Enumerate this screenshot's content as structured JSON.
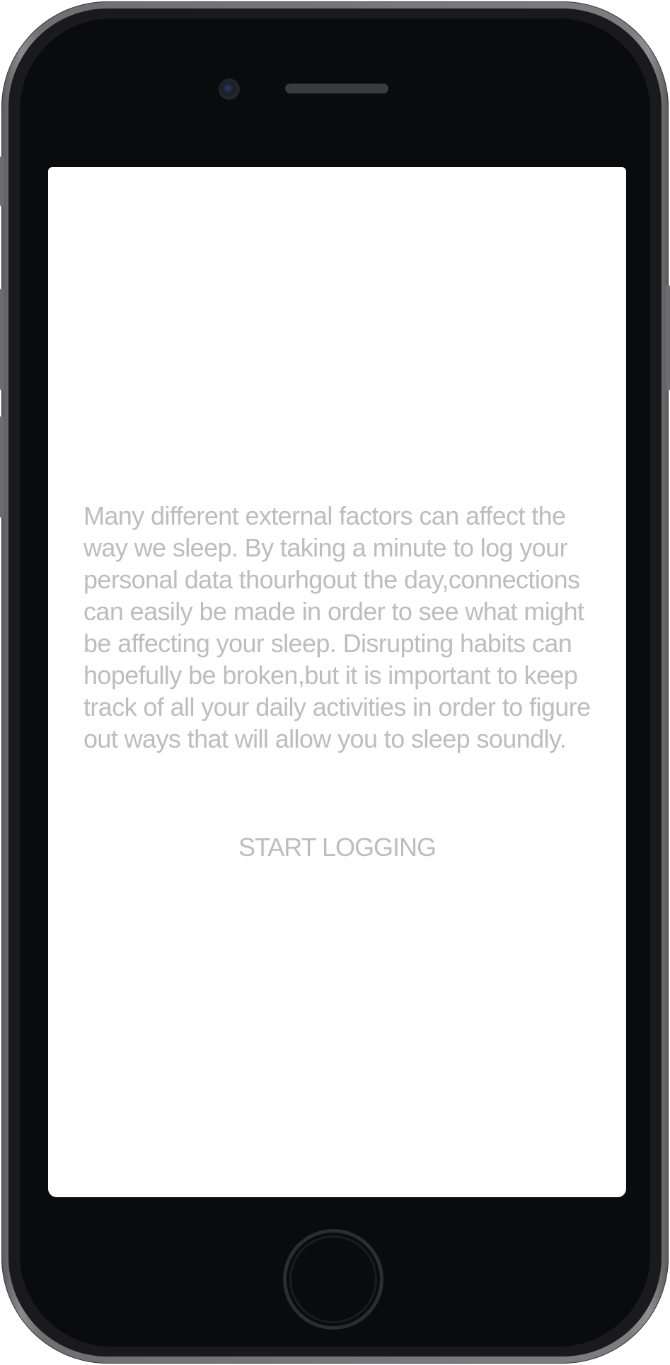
{
  "onboarding": {
    "intro_text": "Many different external factors can affect the way we sleep. By taking a minute to log your personal data thourhgout the day,connections can easily be made in order to see what might be affecting your sleep. Disrupting habits can hopefully be broken,but it is important to keep track of all your daily activities in order to figure out ways that will allow you to sleep soundly.",
    "start_label": "START LOGGING"
  },
  "colors": {
    "text": "#bdbdbd",
    "screen_background": "#ffffff",
    "device_bezel": "#0a0b0d",
    "device_frame": "#7d7d80"
  }
}
